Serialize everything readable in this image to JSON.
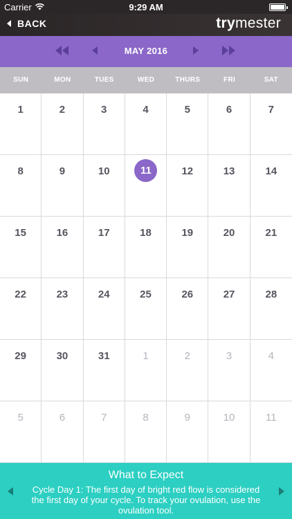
{
  "status_bar": {
    "carrier": "Carrier",
    "time": "9:29 AM",
    "battery_level": 1.0
  },
  "nav_bar": {
    "back_label": "BACK",
    "logo_part_a": "try",
    "logo_part_b": "mester"
  },
  "month_bar": {
    "title": "MAY 2016",
    "icons": [
      "double-chevron-left-icon",
      "chevron-left-icon",
      "chevron-right-icon",
      "double-chevron-right-icon"
    ],
    "color": "#8a67c8"
  },
  "weekdays": [
    "SUN",
    "MON",
    "TUES",
    "WED",
    "THURS",
    "FRI",
    "SAT"
  ],
  "calendar": {
    "selected_day": "11",
    "selected_color": "#8a67c8",
    "days": [
      {
        "label": "1",
        "current": true
      },
      {
        "label": "2",
        "current": true
      },
      {
        "label": "3",
        "current": true
      },
      {
        "label": "4",
        "current": true
      },
      {
        "label": "5",
        "current": true
      },
      {
        "label": "6",
        "current": true
      },
      {
        "label": "7",
        "current": true
      },
      {
        "label": "8",
        "current": true
      },
      {
        "label": "9",
        "current": true
      },
      {
        "label": "10",
        "current": true
      },
      {
        "label": "11",
        "current": true,
        "selected": true
      },
      {
        "label": "12",
        "current": true
      },
      {
        "label": "13",
        "current": true
      },
      {
        "label": "14",
        "current": true
      },
      {
        "label": "15",
        "current": true
      },
      {
        "label": "16",
        "current": true
      },
      {
        "label": "17",
        "current": true
      },
      {
        "label": "18",
        "current": true
      },
      {
        "label": "19",
        "current": true
      },
      {
        "label": "20",
        "current": true
      },
      {
        "label": "21",
        "current": true
      },
      {
        "label": "22",
        "current": true
      },
      {
        "label": "23",
        "current": true
      },
      {
        "label": "24",
        "current": true
      },
      {
        "label": "25",
        "current": true
      },
      {
        "label": "26",
        "current": true
      },
      {
        "label": "27",
        "current": true
      },
      {
        "label": "28",
        "current": true
      },
      {
        "label": "29",
        "current": true
      },
      {
        "label": "30",
        "current": true
      },
      {
        "label": "31",
        "current": true
      },
      {
        "label": "1",
        "current": false
      },
      {
        "label": "2",
        "current": false
      },
      {
        "label": "3",
        "current": false
      },
      {
        "label": "4",
        "current": false
      },
      {
        "label": "5",
        "current": false
      },
      {
        "label": "6",
        "current": false
      },
      {
        "label": "7",
        "current": false
      },
      {
        "label": "8",
        "current": false
      },
      {
        "label": "9",
        "current": false
      },
      {
        "label": "10",
        "current": false
      },
      {
        "label": "11",
        "current": false
      }
    ]
  },
  "expect_panel": {
    "title": "What to Expect",
    "body": "Cycle Day 1: The first day of bright red flow is considered the first day of your cycle. To track your ovulation, use the ovulation tool.",
    "color": "#2ccfc2",
    "icons": [
      "triangle-left-icon",
      "triangle-right-icon"
    ]
  }
}
